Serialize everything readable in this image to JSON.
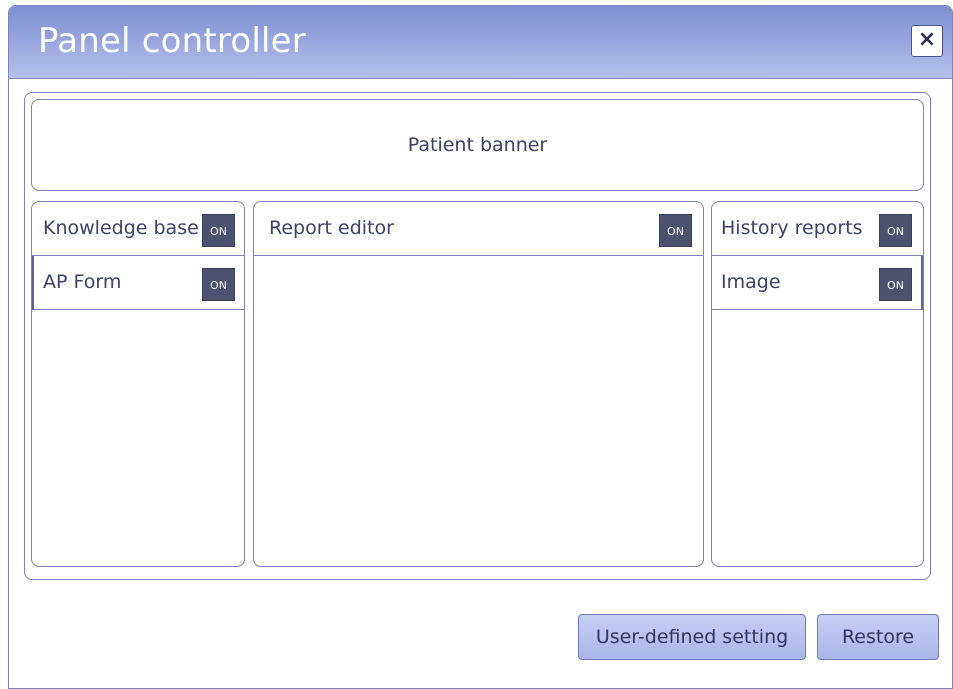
{
  "window": {
    "title": "Panel controller",
    "close_label": "×"
  },
  "banner": {
    "label": "Patient banner"
  },
  "left_column": {
    "items": [
      {
        "label": "Knowledge base",
        "toggle": "ON"
      },
      {
        "label": "AP Form",
        "toggle": "ON"
      }
    ]
  },
  "center_column": {
    "items": [
      {
        "label": "Report editor",
        "toggle": "ON"
      }
    ]
  },
  "right_column": {
    "items": [
      {
        "label": "History reports",
        "toggle": "ON"
      },
      {
        "label": "Image",
        "toggle": "ON"
      }
    ]
  },
  "buttons": {
    "user_defined": "User-defined setting",
    "restore": "Restore"
  }
}
